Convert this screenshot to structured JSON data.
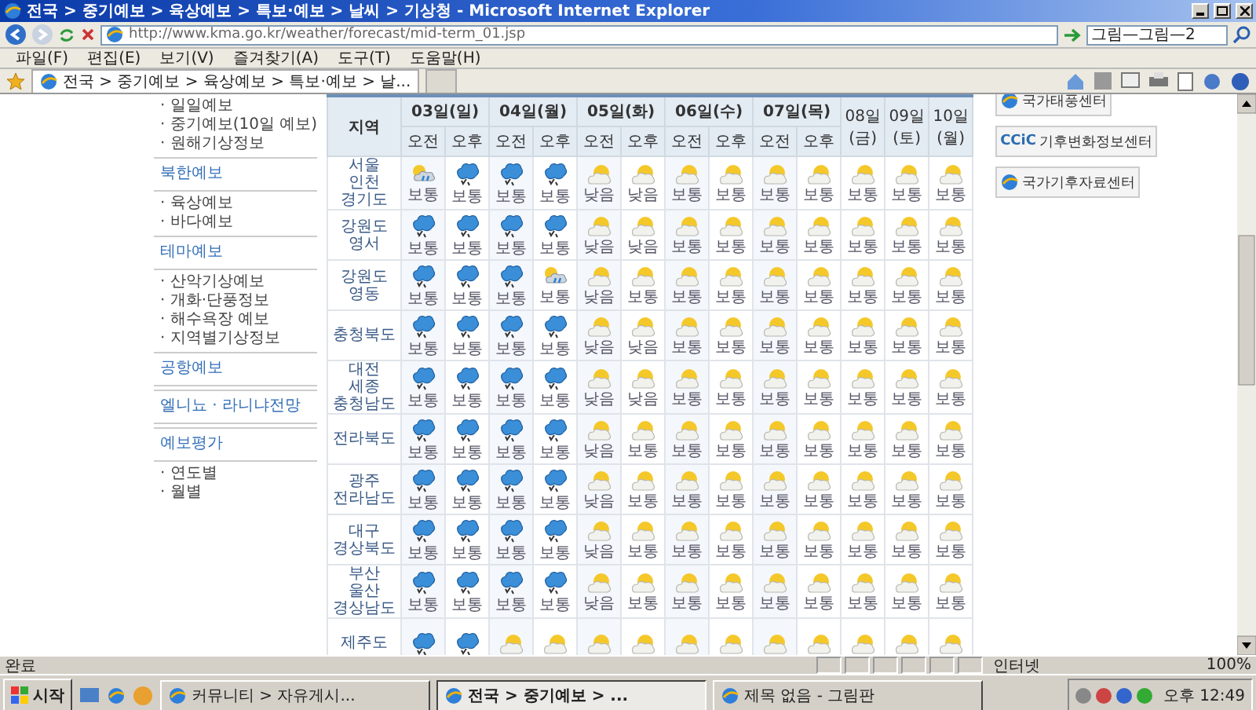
{
  "window": {
    "title": "전국 > 중기예보 > 육상예보 > 특보·예보 > 날씨 > 기상청 - Microsoft Internet Explorer"
  },
  "address_bar": {
    "url": "http://www.kma.go.kr/weather/forecast/mid-term_01.jsp"
  },
  "search": {
    "value": "그림—그림—2"
  },
  "menu": [
    "파일(F)",
    "편집(E)",
    "보기(V)",
    "즐겨찾기(A)",
    "도구(T)",
    "도움말(H)"
  ],
  "tabs": [
    {
      "label": "전국 > 중기예보 > 육상예보 > 특보·예보 > 날...",
      "selected": true
    }
  ],
  "sidebar": {
    "items": [
      {
        "kind": "sub",
        "label": "· 일일예보"
      },
      {
        "kind": "sub",
        "label": "· 중기예보(10일 예보)"
      },
      {
        "kind": "sub",
        "label": "· 원해기상정보"
      },
      {
        "kind": "heading",
        "label": "북한예보"
      },
      {
        "kind": "sub",
        "label": "· 육상예보"
      },
      {
        "kind": "sub",
        "label": "· 바다예보"
      },
      {
        "kind": "heading",
        "label": "테마예보"
      },
      {
        "kind": "sub",
        "label": "· 산악기상예보"
      },
      {
        "kind": "sub",
        "label": "· 개화·단풍정보"
      },
      {
        "kind": "sub",
        "label": "· 해수욕장 예보"
      },
      {
        "kind": "sub",
        "label": "· 지역별기상정보"
      },
      {
        "kind": "heading",
        "label": "공항예보"
      },
      {
        "kind": "heading",
        "label": "엘니뇨 · 라니냐전망"
      },
      {
        "kind": "heading",
        "label": "예보평가"
      },
      {
        "kind": "sub",
        "label": "· 연도별"
      },
      {
        "kind": "sub",
        "label": "· 월별"
      }
    ]
  },
  "table": {
    "region_header": "지역",
    "days": [
      {
        "label": "03일(일)",
        "split": true
      },
      {
        "label": "04일(월)",
        "split": true
      },
      {
        "label": "05일(화)",
        "split": true
      },
      {
        "label": "06일(수)",
        "split": true
      },
      {
        "label": "07일(목)",
        "split": true
      },
      {
        "label": "08일",
        "sub": "(금)",
        "split": false
      },
      {
        "label": "09일",
        "sub": "(토)",
        "split": false
      },
      {
        "label": "10일",
        "sub": "(월)",
        "split": false
      }
    ],
    "halves": [
      "오전",
      "오후",
      "오전",
      "오후",
      "오전",
      "오후",
      "오전",
      "오후",
      "오전",
      "오후"
    ],
    "rows": [
      {
        "region": [
          "서울",
          "인천",
          "경기도"
        ],
        "cells": [
          {
            "kind": "shower",
            "text": "보통"
          },
          {
            "kind": "rain",
            "text": "보통"
          },
          {
            "kind": "rain",
            "text": "보통"
          },
          {
            "kind": "rain",
            "text": "보통"
          },
          {
            "kind": "cloudy",
            "text": "낮음"
          },
          {
            "kind": "cloudy",
            "text": "낮음"
          },
          {
            "kind": "cloudy",
            "text": "보통"
          },
          {
            "kind": "cloudy",
            "text": "보통"
          },
          {
            "kind": "cloudy",
            "text": "보통"
          },
          {
            "kind": "cloudy",
            "text": "보통"
          },
          {
            "kind": "cloudy",
            "text": "보통"
          },
          {
            "kind": "cloudy",
            "text": "보통"
          },
          {
            "kind": "cloudy",
            "text": "보통"
          }
        ]
      },
      {
        "region": [
          "강원도",
          "영서"
        ],
        "cells": [
          {
            "kind": "rain",
            "text": "보통"
          },
          {
            "kind": "rain",
            "text": "보통"
          },
          {
            "kind": "rain",
            "text": "보통"
          },
          {
            "kind": "rain",
            "text": "보통"
          },
          {
            "kind": "cloudy",
            "text": "낮음"
          },
          {
            "kind": "cloudy",
            "text": "낮음"
          },
          {
            "kind": "cloudy",
            "text": "보통"
          },
          {
            "kind": "cloudy",
            "text": "보통"
          },
          {
            "kind": "cloudy",
            "text": "보통"
          },
          {
            "kind": "cloudy",
            "text": "보통"
          },
          {
            "kind": "cloudy",
            "text": "보통"
          },
          {
            "kind": "cloudy",
            "text": "보통"
          },
          {
            "kind": "cloudy",
            "text": "보통"
          }
        ]
      },
      {
        "region": [
          "강원도",
          "영동"
        ],
        "cells": [
          {
            "kind": "rain",
            "text": "보통"
          },
          {
            "kind": "rain",
            "text": "보통"
          },
          {
            "kind": "rain",
            "text": "보통"
          },
          {
            "kind": "shower",
            "text": "보통"
          },
          {
            "kind": "cloudy",
            "text": "낮음"
          },
          {
            "kind": "cloudy",
            "text": "보통"
          },
          {
            "kind": "cloudy",
            "text": "보통"
          },
          {
            "kind": "cloudy",
            "text": "보통"
          },
          {
            "kind": "cloudy",
            "text": "보통"
          },
          {
            "kind": "cloudy",
            "text": "보통"
          },
          {
            "kind": "cloudy",
            "text": "보통"
          },
          {
            "kind": "cloudy",
            "text": "보통"
          },
          {
            "kind": "cloudy",
            "text": "보통"
          }
        ]
      },
      {
        "region": [
          "충청북도"
        ],
        "cells": [
          {
            "kind": "rain",
            "text": "보통"
          },
          {
            "kind": "rain",
            "text": "보통"
          },
          {
            "kind": "rain",
            "text": "보통"
          },
          {
            "kind": "rain",
            "text": "보통"
          },
          {
            "kind": "cloudy",
            "text": "낮음"
          },
          {
            "kind": "cloudy",
            "text": "낮음"
          },
          {
            "kind": "cloudy",
            "text": "보통"
          },
          {
            "kind": "cloudy",
            "text": "보통"
          },
          {
            "kind": "cloudy",
            "text": "보통"
          },
          {
            "kind": "cloudy",
            "text": "보통"
          },
          {
            "kind": "cloudy",
            "text": "보통"
          },
          {
            "kind": "cloudy",
            "text": "보통"
          },
          {
            "kind": "cloudy",
            "text": "보통"
          }
        ]
      },
      {
        "region": [
          "대전",
          "세종",
          "충청남도"
        ],
        "cells": [
          {
            "kind": "rain",
            "text": "보통"
          },
          {
            "kind": "rain",
            "text": "보통"
          },
          {
            "kind": "rain",
            "text": "보통"
          },
          {
            "kind": "rain",
            "text": "보통"
          },
          {
            "kind": "cloudy",
            "text": "낮음"
          },
          {
            "kind": "cloudy",
            "text": "낮음"
          },
          {
            "kind": "cloudy",
            "text": "보통"
          },
          {
            "kind": "cloudy",
            "text": "보통"
          },
          {
            "kind": "cloudy",
            "text": "보통"
          },
          {
            "kind": "cloudy",
            "text": "보통"
          },
          {
            "kind": "cloudy",
            "text": "보통"
          },
          {
            "kind": "cloudy",
            "text": "보통"
          },
          {
            "kind": "cloudy",
            "text": "보통"
          }
        ]
      },
      {
        "region": [
          "전라북도"
        ],
        "cells": [
          {
            "kind": "rain",
            "text": "보통"
          },
          {
            "kind": "rain",
            "text": "보통"
          },
          {
            "kind": "rain",
            "text": "보통"
          },
          {
            "kind": "rain",
            "text": "보통"
          },
          {
            "kind": "cloudy",
            "text": "낮음"
          },
          {
            "kind": "cloudy",
            "text": "보통"
          },
          {
            "kind": "cloudy",
            "text": "보통"
          },
          {
            "kind": "cloudy",
            "text": "보통"
          },
          {
            "kind": "cloudy",
            "text": "보통"
          },
          {
            "kind": "cloudy",
            "text": "보통"
          },
          {
            "kind": "cloudy",
            "text": "보통"
          },
          {
            "kind": "cloudy",
            "text": "보통"
          },
          {
            "kind": "cloudy",
            "text": "보통"
          }
        ]
      },
      {
        "region": [
          "광주",
          "전라남도"
        ],
        "cells": [
          {
            "kind": "rain",
            "text": "보통"
          },
          {
            "kind": "rain",
            "text": "보통"
          },
          {
            "kind": "rain",
            "text": "보통"
          },
          {
            "kind": "rain",
            "text": "보통"
          },
          {
            "kind": "cloudy",
            "text": "낮음"
          },
          {
            "kind": "cloudy",
            "text": "보통"
          },
          {
            "kind": "cloudy",
            "text": "보통"
          },
          {
            "kind": "cloudy",
            "text": "보통"
          },
          {
            "kind": "cloudy",
            "text": "보통"
          },
          {
            "kind": "cloudy",
            "text": "보통"
          },
          {
            "kind": "cloudy",
            "text": "보통"
          },
          {
            "kind": "cloudy",
            "text": "보통"
          },
          {
            "kind": "cloudy",
            "text": "보통"
          }
        ]
      },
      {
        "region": [
          "대구",
          "경상북도"
        ],
        "cells": [
          {
            "kind": "rain",
            "text": "보통"
          },
          {
            "kind": "rain",
            "text": "보통"
          },
          {
            "kind": "rain",
            "text": "보통"
          },
          {
            "kind": "rain",
            "text": "보통"
          },
          {
            "kind": "cloudy",
            "text": "낮음"
          },
          {
            "kind": "cloudy",
            "text": "보통"
          },
          {
            "kind": "cloudy",
            "text": "보통"
          },
          {
            "kind": "cloudy",
            "text": "보통"
          },
          {
            "kind": "cloudy",
            "text": "보통"
          },
          {
            "kind": "cloudy",
            "text": "보통"
          },
          {
            "kind": "cloudy",
            "text": "보통"
          },
          {
            "kind": "cloudy",
            "text": "보통"
          },
          {
            "kind": "cloudy",
            "text": "보통"
          }
        ]
      },
      {
        "region": [
          "부산",
          "울산",
          "경상남도"
        ],
        "cells": [
          {
            "kind": "rain",
            "text": "보통"
          },
          {
            "kind": "rain",
            "text": "보통"
          },
          {
            "kind": "rain",
            "text": "보통"
          },
          {
            "kind": "rain",
            "text": "보통"
          },
          {
            "kind": "cloudy",
            "text": "낮음"
          },
          {
            "kind": "cloudy",
            "text": "보통"
          },
          {
            "kind": "cloudy",
            "text": "보통"
          },
          {
            "kind": "cloudy",
            "text": "보통"
          },
          {
            "kind": "cloudy",
            "text": "보통"
          },
          {
            "kind": "cloudy",
            "text": "보통"
          },
          {
            "kind": "cloudy",
            "text": "보통"
          },
          {
            "kind": "cloudy",
            "text": "보통"
          },
          {
            "kind": "cloudy",
            "text": "보통"
          }
        ]
      },
      {
        "region": [
          "제주도"
        ],
        "cells": [
          {
            "kind": "rain"
          },
          {
            "kind": "rain"
          },
          {
            "kind": "cloudy"
          },
          {
            "kind": "cloudy"
          },
          {
            "kind": "cloudy"
          },
          {
            "kind": "cloudy"
          },
          {
            "kind": "cloudy"
          },
          {
            "kind": "cloudy"
          },
          {
            "kind": "cloudy"
          },
          {
            "kind": "cloudy"
          },
          {
            "kind": "cloudy"
          },
          {
            "kind": "cloudy"
          },
          {
            "kind": "cloudy"
          }
        ]
      }
    ]
  },
  "partner_links": [
    {
      "kind": "typhoon",
      "label": "국가태풍센터"
    },
    {
      "kind": "ccic",
      "label": "기후변화정보센터",
      "badge": "CCiC"
    },
    {
      "kind": "archive",
      "label": "국가기후자료센터"
    }
  ],
  "status_bar": {
    "text": "완료",
    "zone": "인터넷",
    "zoom": "100%"
  },
  "taskbar": {
    "start": "시작",
    "tasks": [
      {
        "label": "커뮤니티 > 자유게시...",
        "selected": false
      },
      {
        "label": "전국 > 중기예보 > ...",
        "selected": true
      },
      {
        "label": "제목 없음 - 그림판",
        "selected": false
      }
    ],
    "clock": "오후 12:49"
  }
}
